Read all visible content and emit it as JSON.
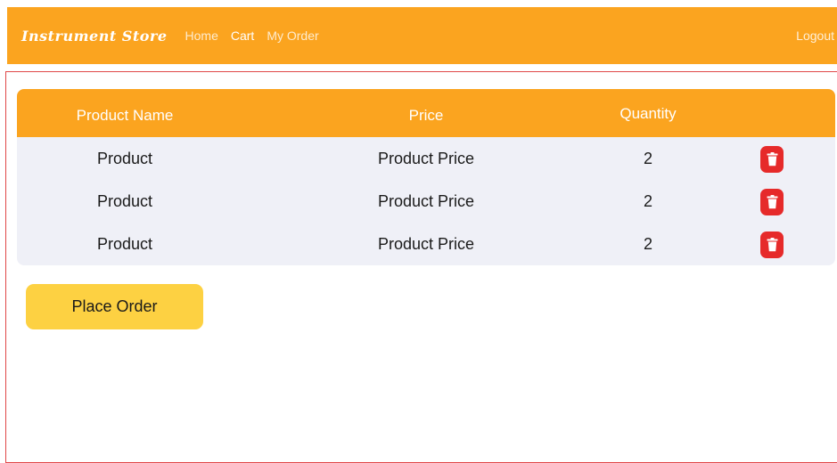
{
  "navbar": {
    "brand": "Instrument Store",
    "links": [
      "Home",
      "Cart",
      "My Order"
    ],
    "active_link": "Cart",
    "logout_label": "Logout"
  },
  "cart_table": {
    "headers": {
      "product_name": "Product Name",
      "price": "Price",
      "quantity": "Quantity"
    },
    "rows": [
      {
        "product": "Product",
        "price": "Product Price",
        "quantity": "2"
      },
      {
        "product": "Product",
        "price": "Product Price",
        "quantity": "2"
      },
      {
        "product": "Product",
        "price": "Product Price",
        "quantity": "2"
      }
    ],
    "delete_icon": "trash-icon"
  },
  "actions": {
    "place_order_label": "Place Order"
  },
  "colors": {
    "navbar": "#fba41f",
    "table_header": "#fba41f",
    "table_body": "#eff0f7",
    "delete_button": "#e62a2a",
    "place_order_button": "#fdd142",
    "frame_border": "#e04848"
  }
}
